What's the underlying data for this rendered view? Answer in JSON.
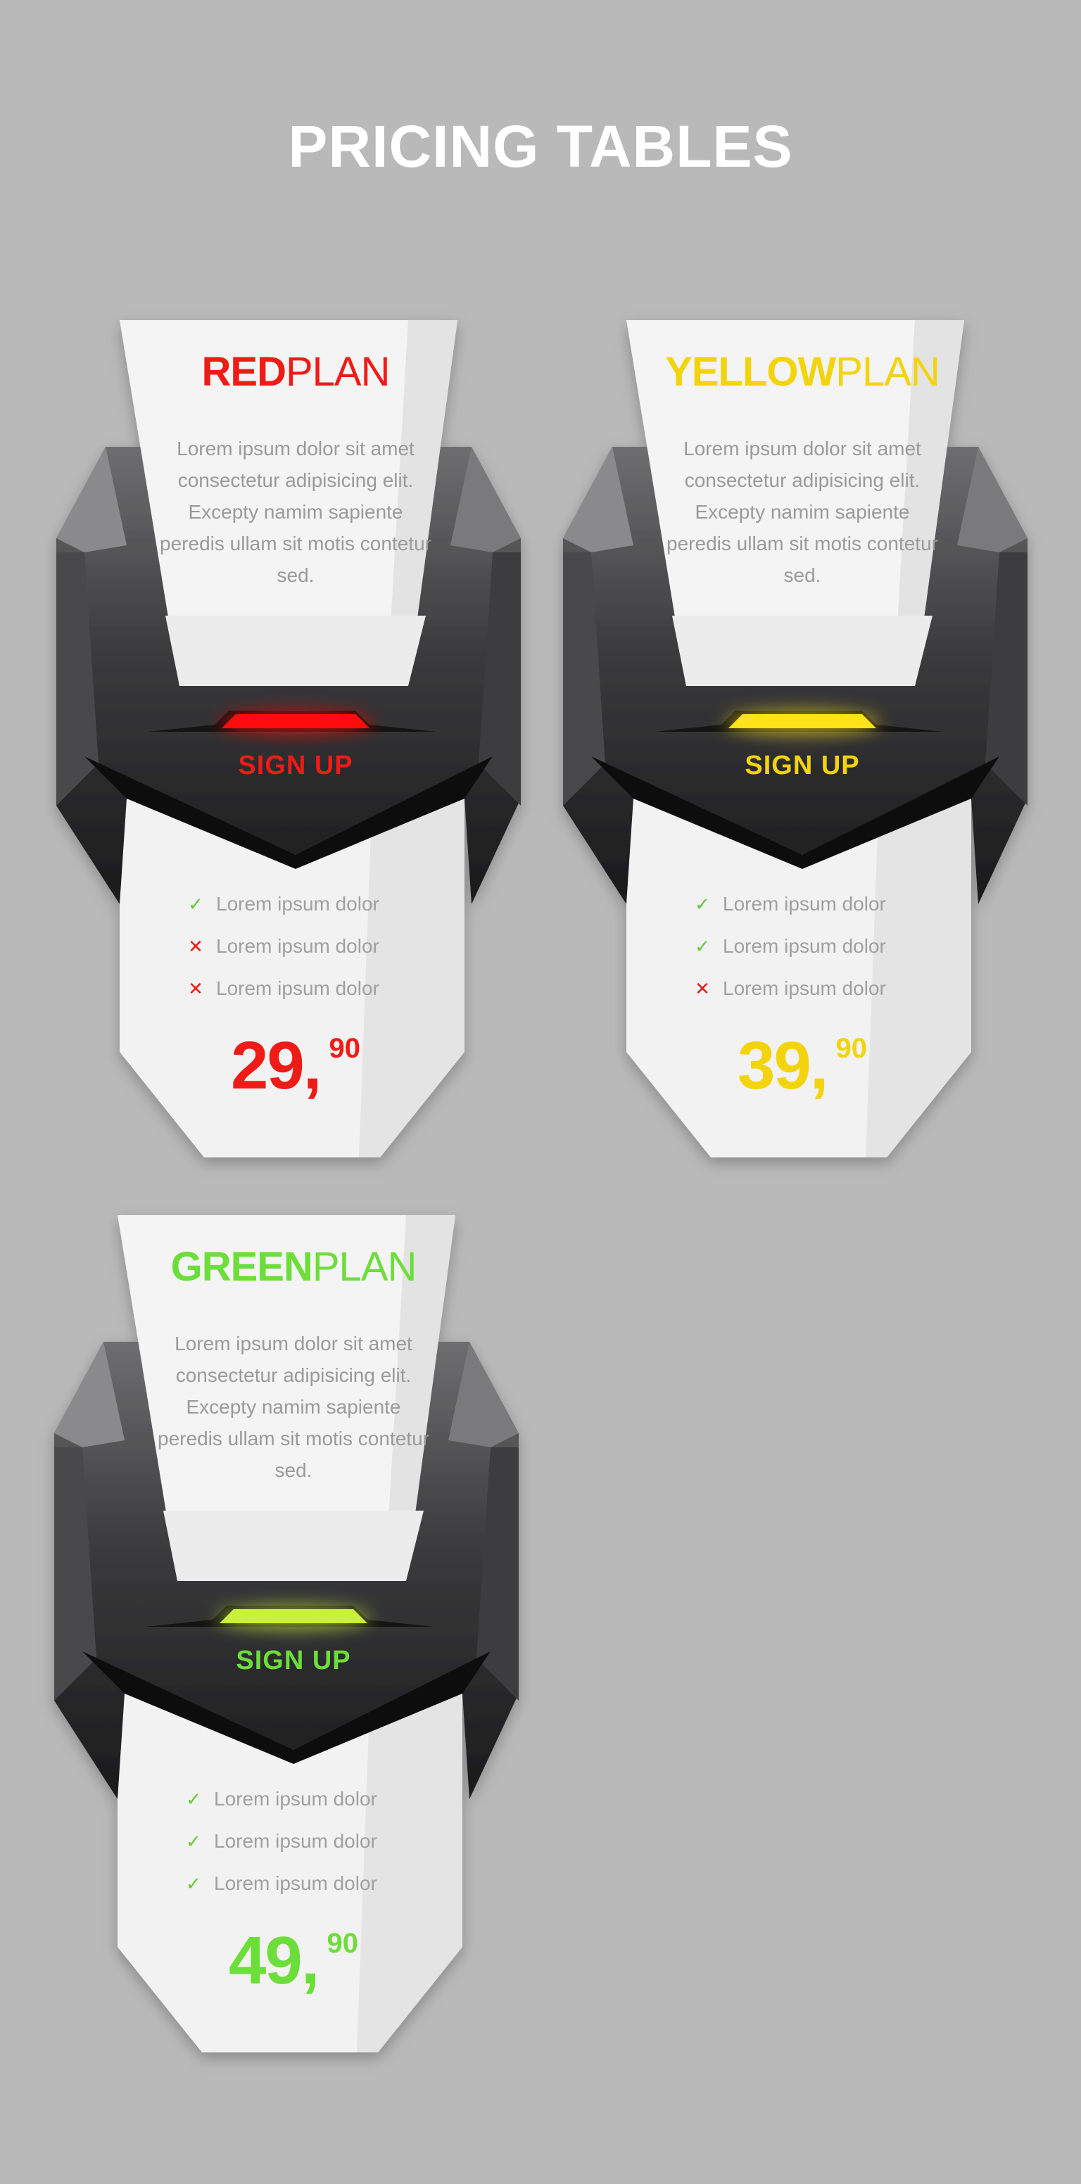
{
  "page": {
    "title": "PRICING TABLES"
  },
  "plans": [
    {
      "title_bold": "RED",
      "title_light": "PLAN",
      "color": "#ef1b16",
      "glow": "#ff0d0d",
      "description": "Lorem ipsum dolor sit amet consectetur adipisicing elit. Excepty namim sapiente peredis ullam sit motis contetur sed.",
      "signup_label": "SIGN UP",
      "features": [
        {
          "icon": "check-icon",
          "text": "Lorem ipsum dolor"
        },
        {
          "icon": "cross-icon",
          "text": "Lorem ipsum dolor"
        },
        {
          "icon": "cross-icon",
          "text": "Lorem ipsum dolor"
        }
      ],
      "price": "29,",
      "cents": "90"
    },
    {
      "title_bold": "YELLOW",
      "title_light": "PLAN",
      "color": "#f3d30c",
      "glow": "#ffe21a",
      "description": "Lorem ipsum dolor sit amet consectetur adipisicing elit. Excepty namim sapiente peredis ullam sit motis contetur sed.",
      "signup_label": "SIGN UP",
      "features": [
        {
          "icon": "check-icon",
          "text": "Lorem ipsum dolor"
        },
        {
          "icon": "check-icon",
          "text": "Lorem ipsum dolor"
        },
        {
          "icon": "cross-icon",
          "text": "Lorem ipsum dolor"
        }
      ],
      "price": "39,",
      "cents": "90"
    },
    {
      "title_bold": "GREEN",
      "title_light": "PLAN",
      "color": "#6cde3a",
      "glow": "#c9f03a",
      "description": "Lorem ipsum dolor sit amet consectetur adipisicing elit. Excepty namim sapiente peredis ullam sit motis contetur sed.",
      "signup_label": "SIGN UP",
      "features": [
        {
          "icon": "check-icon",
          "text": "Lorem ipsum dolor"
        },
        {
          "icon": "check-icon",
          "text": "Lorem ipsum dolor"
        },
        {
          "icon": "check-icon",
          "text": "Lorem ipsum dolor"
        }
      ],
      "price": "49,",
      "cents": "90"
    }
  ]
}
